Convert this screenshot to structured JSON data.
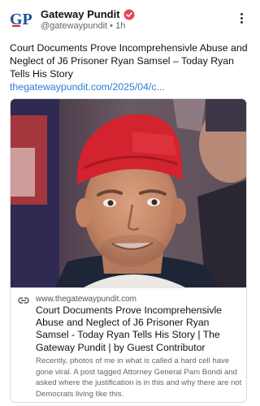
{
  "author": {
    "avatar_label": "GP",
    "name": "Gateway Pundit",
    "handle": "@gatewaypundit",
    "separator": "•",
    "time": "1h"
  },
  "post": {
    "text": "Court Documents Prove Incomprehensivle Abuse and Neglect of J6 Prisoner Ryan Samsel – Today Ryan Tells His Story",
    "link": "thegatewaypundit.com/2025/04/c..."
  },
  "card": {
    "domain": "www.thegatewaypundit.com",
    "title": "Court Documents Prove Incomprehensivle Abuse and Neglect of J6 Prisoner Ryan Samsel - Today Ryan Tells His Story | The Gateway Pundit | by Guest Contributor",
    "description": "Recently, photos of me in what is called a hard cell have gone viral. A post tagged Attorney General Pam Bondi and asked where the justification is in this and why there are not Democrats living like this."
  },
  "colors": {
    "verified": "#e8435a",
    "link": "#2f7bd9",
    "brand_blue": "#1f4e9b",
    "brand_red": "#d9252b"
  },
  "icons": {
    "verified": "verified-badge-icon",
    "more": "more-vertical-icon",
    "link": "link-icon"
  }
}
